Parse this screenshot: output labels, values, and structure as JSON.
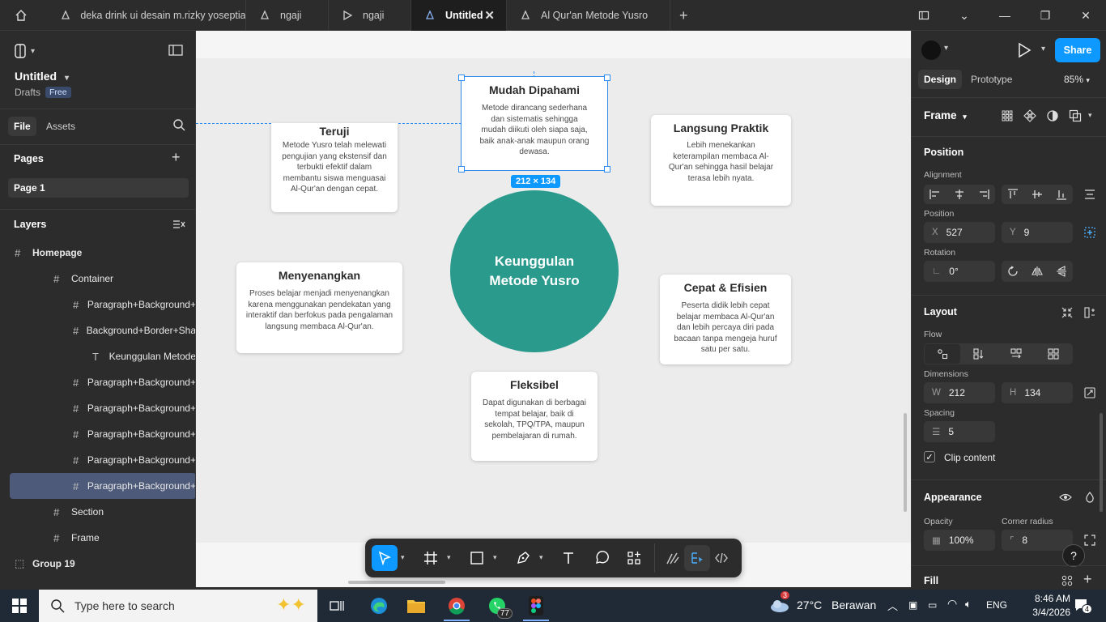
{
  "tabs": [
    {
      "label": "deka drink ui desain m.rizky yoseptian",
      "active": false
    },
    {
      "label": "ngaji",
      "active": false
    },
    {
      "label": "ngaji",
      "active": false
    },
    {
      "label": "Untitled",
      "active": true
    },
    {
      "label": "Al Qur'an Metode Yusro",
      "active": false
    }
  ],
  "left_panel": {
    "file_name": "Untitled",
    "drafts": "Drafts",
    "plan_badge": "Free",
    "tab_file": "File",
    "tab_assets": "Assets",
    "pages_title": "Pages",
    "page_1": "Page 1",
    "layers_title": "Layers",
    "layers": [
      {
        "name": "Homepage",
        "indent": 0,
        "icon": "frame-icon"
      },
      {
        "name": "Container",
        "indent": 1,
        "icon": "frame-icon"
      },
      {
        "name": "Paragraph+Background+",
        "indent": 2,
        "icon": "frame-icon"
      },
      {
        "name": "Background+Border+Sha",
        "indent": 2,
        "icon": "frame-icon"
      },
      {
        "name": "Keunggulan Metode",
        "indent": 3,
        "icon": "text-icon"
      },
      {
        "name": "Paragraph+Background+",
        "indent": 2,
        "icon": "frame-icon"
      },
      {
        "name": "Paragraph+Background+",
        "indent": 2,
        "icon": "frame-icon"
      },
      {
        "name": "Paragraph+Background+",
        "indent": 2,
        "icon": "frame-icon"
      },
      {
        "name": "Paragraph+Background+",
        "indent": 2,
        "icon": "frame-icon"
      },
      {
        "name": "Paragraph+Background+",
        "indent": 2,
        "icon": "frame-icon",
        "selected": true
      },
      {
        "name": "Section",
        "indent": 1,
        "icon": "frame-icon"
      },
      {
        "name": "Frame",
        "indent": 1,
        "icon": "frame-icon"
      },
      {
        "name": "Group 19",
        "indent": 0,
        "icon": "group-icon"
      }
    ]
  },
  "canvas": {
    "center_line1": "Keunggulan",
    "center_line2": "Metode Yusro",
    "selection_size": "212 × 134",
    "cards": {
      "mudah": {
        "title": "Mudah Dipahami",
        "desc": "Metode dirancang sederhana dan sistematis sehingga mudah diikuti oleh siapa saja, baik anak-anak maupun orang dewasa."
      },
      "teruji": {
        "title": "Teruji",
        "desc": "Metode Yusro telah melewati pengujian yang ekstensif dan terbukti efektif dalam membantu siswa menguasai Al-Qur'an dengan cepat."
      },
      "praktik": {
        "title": "Langsung Praktik",
        "desc": "Lebih menekankan keterampilan membaca Al-Qur'an sehingga hasil belajar terasa lebih nyata."
      },
      "menyenangkan": {
        "title": "Menyenangkan",
        "desc": "Proses belajar menjadi menyenangkan karena menggunakan pendekatan yang interaktif dan berfokus pada pengalaman langsung membaca Al-Qur'an."
      },
      "cepat": {
        "title": "Cepat & Efisien",
        "desc": "Peserta didik lebih cepat belajar membaca Al-Qur'an dan lebih percaya diri pada bacaan tanpa mengeja huruf satu per satu."
      },
      "fleksibel": {
        "title": "Fleksibel",
        "desc": "Dapat digunakan di berbagai tempat belajar, baik di sekolah, TPQ/TPA, maupun pembelajaran di rumah."
      }
    }
  },
  "right_panel": {
    "share_label": "Share",
    "tab_design": "Design",
    "tab_prototype": "Prototype",
    "zoom": "85%",
    "frame_label": "Frame",
    "position_title": "Position",
    "alignment_label": "Alignment",
    "position_label": "Position",
    "x_prefix": "X",
    "x_value": "527",
    "y_prefix": "Y",
    "y_value": "9",
    "rotation_label": "Rotation",
    "rotation_value": "0°",
    "layout_title": "Layout",
    "flow_label": "Flow",
    "dimensions_label": "Dimensions",
    "w_prefix": "W",
    "w_value": "212",
    "h_prefix": "H",
    "h_value": "134",
    "spacing_label": "Spacing",
    "spacing_value": "5",
    "clip_content": "Clip content",
    "appearance_title": "Appearance",
    "opacity_label": "Opacity",
    "opacity_value": "100%",
    "corner_radius_label": "Corner radius",
    "corner_radius_value": "8",
    "fill_title": "Fill",
    "help": "?"
  },
  "taskbar": {
    "search_placeholder": "Type here to search",
    "weather_temp": "27°C",
    "weather_desc": "Berawan",
    "weather_badge": "3",
    "language": "ENG",
    "time": "8:46 AM",
    "date": "3/4/2026",
    "whatsapp_badge": "77",
    "notification_count": "4"
  },
  "colors": {
    "accent": "#0d99ff",
    "circle": "#2a9a8c",
    "selected_layer": "#4d5a7a"
  }
}
